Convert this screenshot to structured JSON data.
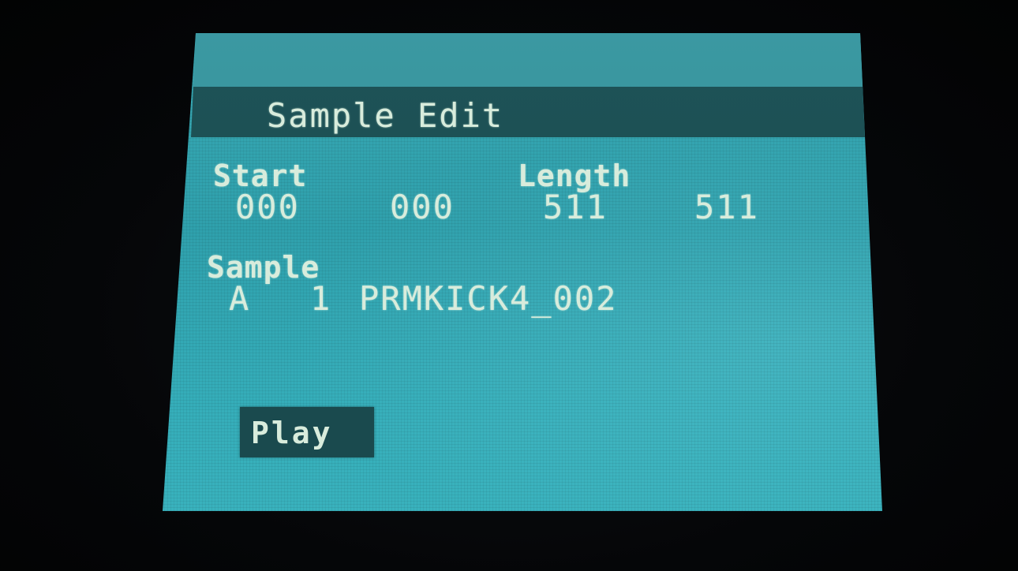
{
  "screen": {
    "title": "Sample Edit",
    "start": {
      "label": "Start",
      "value_1": "000",
      "value_2": "000"
    },
    "length": {
      "label": "Length",
      "value_1": "511",
      "value_2": "511"
    },
    "sample": {
      "label": "Sample",
      "bank": "A",
      "number": "1",
      "name": "PRMKICK4_002"
    },
    "play_button": {
      "label": "Play"
    }
  },
  "colors": {
    "lcd_background": "#35adb9",
    "header_bar": "#1e5357",
    "text": "#d8ecdc",
    "button_background": "#1a4a4e"
  }
}
